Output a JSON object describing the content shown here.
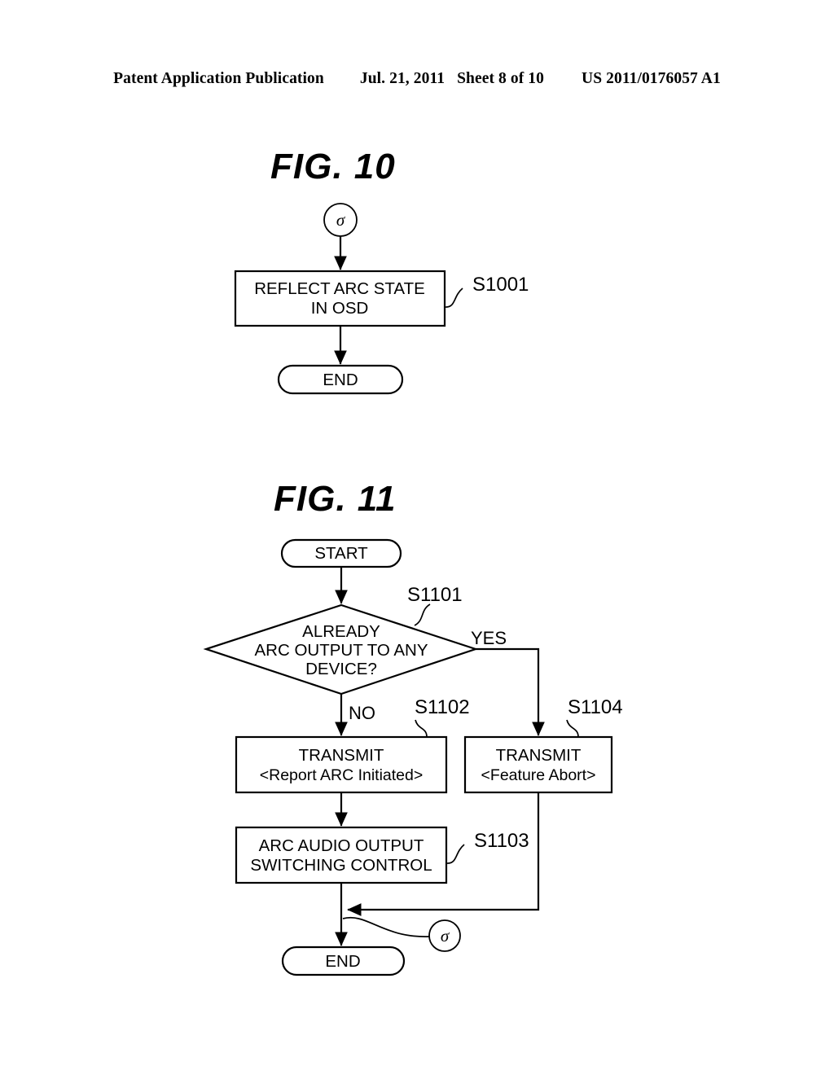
{
  "header": {
    "publication": "Patent Application Publication",
    "date": "Jul. 21, 2011",
    "sheet": "Sheet 8 of 10",
    "doc_number": "US 2011/0176057 A1"
  },
  "figures": [
    {
      "id": "fig10",
      "title": "FIG.  10",
      "nodes": {
        "connector_in": "σ",
        "process_line1": "REFLECT ARC STATE",
        "process_line2": "IN OSD",
        "process_label": "S1001",
        "end": "END"
      }
    },
    {
      "id": "fig11",
      "title": "FIG.  11",
      "nodes": {
        "start": "START",
        "decision_line1": "ALREADY",
        "decision_line2": "ARC OUTPUT TO ANY",
        "decision_line3": "DEVICE?",
        "decision_label": "S1101",
        "branch_yes": "YES",
        "branch_no": "NO",
        "transmit_report_line1": "TRANSMIT",
        "transmit_report_line2": "<Report ARC Initiated>",
        "transmit_report_label": "S1102",
        "transmit_abort_line1": "TRANSMIT",
        "transmit_abort_line2": "<Feature Abort>",
        "transmit_abort_label": "S1104",
        "switching_line1": "ARC AUDIO OUTPUT",
        "switching_line2": "SWITCHING CONTROL",
        "switching_label": "S1103",
        "connector_out": "σ",
        "end": "END"
      }
    }
  ],
  "colors": {
    "ink": "#000000",
    "paper": "#ffffff"
  }
}
